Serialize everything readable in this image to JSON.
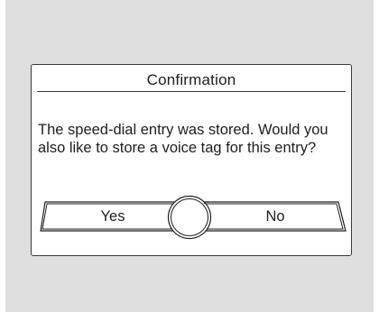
{
  "dialog": {
    "title": "Confirmation",
    "message": "The speed-dial entry was stored. Would you also like to store a voice tag for this entry?",
    "buttons": {
      "yes_label": "Yes",
      "no_label": "No"
    }
  },
  "colors": {
    "screen_background": "#dfdfdf",
    "dialog_background": "#ffffff",
    "border": "#3a3a3a",
    "text": "#1e1e1e"
  },
  "icons": {
    "selector": "rotary-controller-knob-icon"
  }
}
